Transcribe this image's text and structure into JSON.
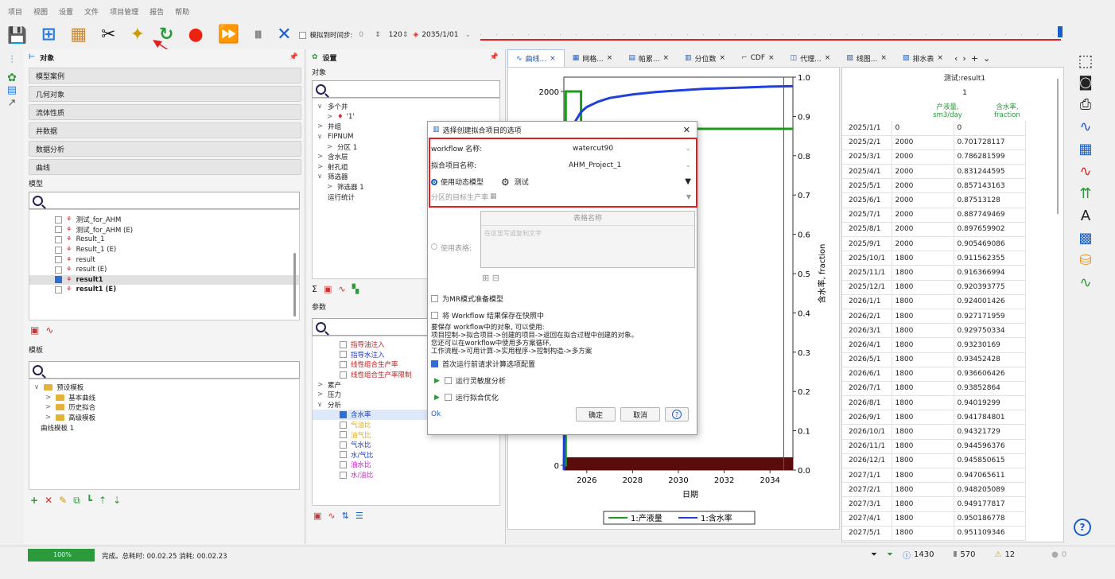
{
  "menu": [
    "项目",
    "视图",
    "设置",
    "文件",
    "项目管理",
    "报告",
    "帮助"
  ],
  "toolbar": {
    "sim_label": "模拟到时间步:",
    "sim_value": "0",
    "count": "120",
    "date": "2035/1/01"
  },
  "left_panel": {
    "title": "对象",
    "sections": [
      "模型案例",
      "几何对象",
      "流体性质",
      "井数据",
      "数据分析",
      "曲线"
    ],
    "models_label": "模型",
    "models": [
      {
        "label": "测试_for_AHM",
        "checked": false,
        "bold": false
      },
      {
        "label": "测试_for_AHM (E)",
        "checked": false,
        "bold": false
      },
      {
        "label": "Result_1",
        "checked": false,
        "bold": false
      },
      {
        "label": "Result_1 (E)",
        "checked": false,
        "bold": false
      },
      {
        "label": "result",
        "checked": false,
        "bold": false
      },
      {
        "label": "result (E)",
        "checked": false,
        "bold": false
      },
      {
        "label": "result1",
        "checked": true,
        "bold": true
      },
      {
        "label": "result1 (E)",
        "checked": false,
        "bold": true
      }
    ],
    "templates_label": "模板",
    "templates": [
      {
        "label": "预设模板",
        "level": 0
      },
      {
        "label": "基本曲线",
        "level": 1
      },
      {
        "label": "历史拟合",
        "level": 1
      },
      {
        "label": "高级模板",
        "level": 1
      },
      {
        "label": "曲线模板 1",
        "level": -1
      }
    ]
  },
  "settings_panel": {
    "title": "设置",
    "objects_label": "对象",
    "tree": [
      {
        "label": "多个井",
        "ind": 0,
        "arrow": "∨"
      },
      {
        "label": "'1'",
        "ind": 1,
        "arrow": ">"
      },
      {
        "label": "井组",
        "ind": 0,
        "arrow": ">"
      },
      {
        "label": "FIPNUM",
        "ind": 0,
        "arrow": "∨"
      },
      {
        "label": "分区 1",
        "ind": 1,
        "arrow": ">"
      },
      {
        "label": "含水层",
        "ind": 0,
        "arrow": ">"
      },
      {
        "label": "射孔组",
        "ind": 0,
        "arrow": ">"
      },
      {
        "label": "筛选器",
        "ind": 0,
        "arrow": "∨"
      },
      {
        "label": "筛选器 1",
        "ind": 1,
        "arrow": ">"
      },
      {
        "label": "运行统计",
        "ind": 0,
        "arrow": ""
      }
    ],
    "params_label": "参数",
    "params": [
      {
        "label": "指导油注入",
        "ind": 1,
        "cb": true,
        "color": "#c02020",
        "checked": false
      },
      {
        "label": "指导水注入",
        "ind": 1,
        "cb": true,
        "color": "#2030c0",
        "checked": false
      },
      {
        "label": "线性组合生产率",
        "ind": 1,
        "cb": true,
        "color": "#c02020",
        "checked": false
      },
      {
        "label": "线性组合生产率限制",
        "ind": 1,
        "cb": true,
        "color": "#c02020",
        "checked": false
      },
      {
        "label": "累产",
        "ind": 0,
        "cb": false,
        "arrow": ">",
        "color": "#222"
      },
      {
        "label": "压力",
        "ind": 0,
        "cb": false,
        "arrow": ">",
        "color": "#222"
      },
      {
        "label": "分析",
        "ind": 0,
        "cb": false,
        "arrow": "∨",
        "color": "#222"
      },
      {
        "label": "含水率",
        "ind": 1,
        "cb": true,
        "color": "#2040c0",
        "checked": true
      },
      {
        "label": "气油比",
        "ind": 1,
        "cb": true,
        "color": "#e0b020",
        "checked": false
      },
      {
        "label": "油气比",
        "ind": 1,
        "cb": true,
        "color": "#e0b020",
        "checked": false
      },
      {
        "label": "气水比",
        "ind": 1,
        "cb": true,
        "color": "#2040c0",
        "checked": false
      },
      {
        "label": "水/气比",
        "ind": 1,
        "cb": true,
        "color": "#2040c0",
        "checked": false
      },
      {
        "label": "油水比",
        "ind": 1,
        "cb": true,
        "color": "#d020d0",
        "checked": false
      },
      {
        "label": "水/油比",
        "ind": 1,
        "cb": true,
        "color": "#d020d0",
        "checked": false
      }
    ]
  },
  "tabs": [
    {
      "label": "曲线...",
      "icon": "line-chart-icon",
      "active": true
    },
    {
      "label": "网格...",
      "icon": "grid-icon",
      "active": false
    },
    {
      "label": "帕累...",
      "icon": "pareto-icon",
      "active": false
    },
    {
      "label": "分位数",
      "icon": "quantile-icon",
      "active": false
    },
    {
      "label": "CDF",
      "icon": "cdf-icon",
      "active": false
    },
    {
      "label": "代理...",
      "icon": "proxy-icon",
      "active": false
    },
    {
      "label": "线图...",
      "icon": "line-plot-icon",
      "active": false
    },
    {
      "label": "排水表",
      "icon": "table-icon",
      "active": false
    }
  ],
  "chart_data": {
    "type": "line",
    "xlabel": "日期",
    "ylabel_right": "含水率, fraction",
    "x_ticks": [
      "2026",
      "2028",
      "2030",
      "2032",
      "2034"
    ],
    "y_left_ticks": [
      "2000",
      "0"
    ],
    "y_right_ticks": [
      "1.0",
      "0.9",
      "0.8",
      "0.7",
      "0.6",
      "0.5",
      "0.4",
      "0.3",
      "0.2",
      "0.1",
      "0.0"
    ],
    "ylim_right": [
      0,
      1
    ],
    "xlim": [
      2025.0,
      2035.0
    ],
    "series": [
      {
        "name": "1:产液量",
        "color": "#1a9c1a",
        "x": [
          2025.0,
          2025.08,
          2025.08,
          2025.75,
          2025.75,
          2035.0
        ],
        "values": [
          0,
          0,
          2000,
          2000,
          1800,
          1800
        ]
      },
      {
        "name": "1:含水率",
        "color": "#1f3fe0",
        "x": [
          2025.0,
          2025.08,
          2025.17,
          2025.25,
          2025.33,
          2025.5,
          2025.75,
          2026.0,
          2026.5,
          2027.0,
          2028.0,
          2029.0,
          2030.0,
          2031.0,
          2032.0,
          2033.0,
          2034.0,
          2035.0
        ],
        "values": [
          0,
          0.7017,
          0.7863,
          0.8312,
          0.8571,
          0.8877,
          0.9115,
          0.924,
          0.9377,
          0.947,
          0.956,
          0.962,
          0.966,
          0.97,
          0.972,
          0.974,
          0.976,
          0.977
        ]
      }
    ],
    "legend": [
      "1:产液量",
      "1:含水率"
    ]
  },
  "table": {
    "title": "测试:result1",
    "subtitle": "1",
    "col1": "产液量,\nsm3/day",
    "col2": "含水率,\nfraction",
    "rows": [
      [
        "2025/1/1",
        "0",
        "0"
      ],
      [
        "2025/2/1",
        "2000",
        "0.701728117"
      ],
      [
        "2025/3/1",
        "2000",
        "0.786281599"
      ],
      [
        "2025/4/1",
        "2000",
        "0.831244595"
      ],
      [
        "2025/5/1",
        "2000",
        "0.857143163"
      ],
      [
        "2025/6/1",
        "2000",
        "0.87513128"
      ],
      [
        "2025/7/1",
        "2000",
        "0.887749469"
      ],
      [
        "2025/8/1",
        "2000",
        "0.897659902"
      ],
      [
        "2025/9/1",
        "2000",
        "0.905469086"
      ],
      [
        "2025/10/1",
        "1800",
        "0.911562355"
      ],
      [
        "2025/11/1",
        "1800",
        "0.916366994"
      ],
      [
        "2025/12/1",
        "1800",
        "0.920393775"
      ],
      [
        "2026/1/1",
        "1800",
        "0.924001426"
      ],
      [
        "2026/2/1",
        "1800",
        "0.927171959"
      ],
      [
        "2026/3/1",
        "1800",
        "0.929750334"
      ],
      [
        "2026/4/1",
        "1800",
        "0.93230169"
      ],
      [
        "2026/5/1",
        "1800",
        "0.93452428"
      ],
      [
        "2026/6/1",
        "1800",
        "0.936606426"
      ],
      [
        "2026/7/1",
        "1800",
        "0.93852864"
      ],
      [
        "2026/8/1",
        "1800",
        "0.94019299"
      ],
      [
        "2026/9/1",
        "1800",
        "0.941784801"
      ],
      [
        "2026/10/1",
        "1800",
        "0.94321729"
      ],
      [
        "2026/11/1",
        "1800",
        "0.944596376"
      ],
      [
        "2026/12/1",
        "1800",
        "0.945850615"
      ],
      [
        "2027/1/1",
        "1800",
        "0.947065611"
      ],
      [
        "2027/2/1",
        "1800",
        "0.948205089"
      ],
      [
        "2027/3/1",
        "1800",
        "0.949177817"
      ],
      [
        "2027/4/1",
        "1800",
        "0.950186778"
      ],
      [
        "2027/5/1",
        "1800",
        "0.951109346"
      ]
    ]
  },
  "dialog": {
    "title": "选择创建拟合项目的选项",
    "workflow_label": "workflow 名称:",
    "workflow_value": "watercut90",
    "project_label": "拟合项目名称:",
    "project_value": "AHM_Project_1",
    "use_model_label": "使用动态模型",
    "model_value": "测试",
    "partition_label": "分区的目标生产率",
    "table_header": "表格名称",
    "table_placeholder": "在这里写或复制文字",
    "use_table_label": "使用表格:",
    "mr_label": "为MR模式准备模型",
    "save_label": "将 Workflow 结果保存在快照中",
    "info": [
      "要保存 workflow中的对象, 可以使用:",
      "项目控制->拟合项目->创建的项目->返回在拟合过程中创建的对象。",
      "您还可以在workflow中使用多方案循环,",
      "工作流程->可用计算->实用程序->控制构造->多方案"
    ],
    "first_run_label": "首次运行前请求计算选项配置",
    "sensitivity_label": "运行灵敏度分析",
    "optimization_label": "运行拟合优化",
    "ok_label": "确定",
    "cancel_label": "取消",
    "help_label": "?",
    "ok_corner": "Ok"
  },
  "status": {
    "progress": "100%",
    "message": "完成。总耗时: 00.02.25 消耗: 00.02.23",
    "count1": "1430",
    "count2": "570",
    "count3": "12",
    "count4": "0"
  },
  "colors": {
    "accent": "#2c6dd8",
    "highlight": "#e02020",
    "green": "#1a9c1a",
    "blue": "#1f3fe0"
  }
}
